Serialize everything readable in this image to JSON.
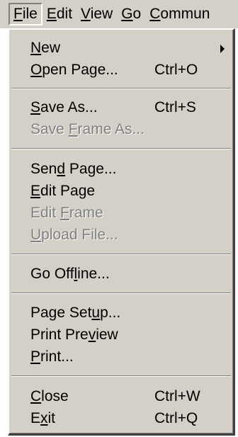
{
  "menubar": {
    "items": [
      {
        "pre": "",
        "mn": "F",
        "post": "ile"
      },
      {
        "pre": "",
        "mn": "E",
        "post": "dit"
      },
      {
        "pre": "",
        "mn": "V",
        "post": "iew"
      },
      {
        "pre": "",
        "mn": "G",
        "post": "o"
      },
      {
        "pre": "",
        "mn": "C",
        "post": "ommun"
      }
    ]
  },
  "menu": {
    "new": {
      "pre": "",
      "mn": "N",
      "post": "ew"
    },
    "open_page": {
      "pre": "",
      "mn": "O",
      "post": "pen Page...",
      "shortcut": "Ctrl+O"
    },
    "save_as": {
      "pre": "",
      "mn": "S",
      "post": "ave As...",
      "shortcut": "Ctrl+S"
    },
    "save_frame_as": {
      "pre": "Save ",
      "mn": "F",
      "post": "rame As..."
    },
    "send_page": {
      "pre": "Sen",
      "mn": "d",
      "post": " Page..."
    },
    "edit_page": {
      "pre": "",
      "mn": "E",
      "post": "dit Page"
    },
    "edit_frame": {
      "pre": "Edit ",
      "mn": "F",
      "post": "rame"
    },
    "upload_file": {
      "pre": "",
      "mn": "U",
      "post": "pload File..."
    },
    "go_offline": {
      "pre": "Go Off",
      "mn": "l",
      "post": "ine..."
    },
    "page_setup": {
      "pre": "Page Set",
      "mn": "u",
      "post": "p..."
    },
    "print_preview": {
      "pre": "Print Pre",
      "mn": "v",
      "post": "iew"
    },
    "print": {
      "pre": "",
      "mn": "P",
      "post": "rint..."
    },
    "close": {
      "pre": "",
      "mn": "C",
      "post": "lose",
      "shortcut": "Ctrl+W"
    },
    "exit": {
      "pre": "E",
      "mn": "x",
      "post": "it",
      "shortcut": "Ctrl+Q"
    }
  },
  "colors": {
    "menu_bg": "#d4d0c8",
    "disabled_text": "#808080"
  }
}
